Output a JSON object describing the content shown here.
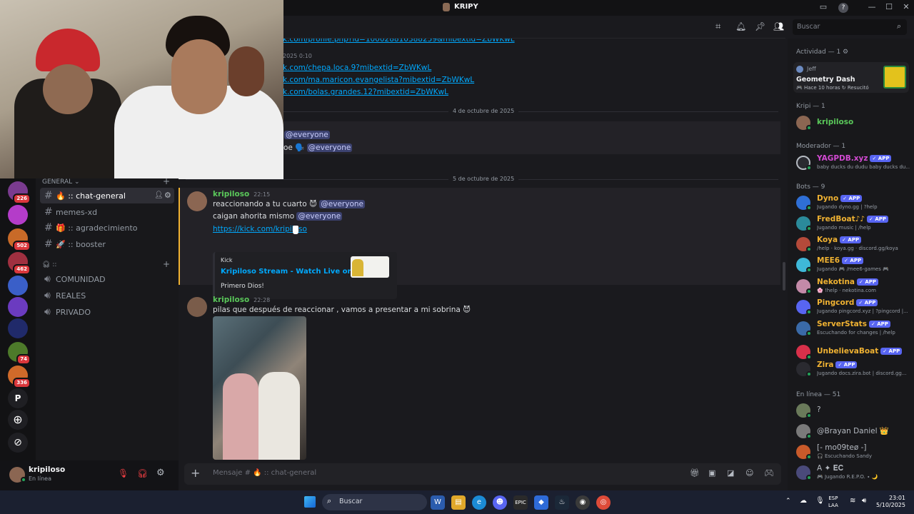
{
  "window": {
    "title": "KRIPY"
  },
  "header": {
    "search_placeholder": "Buscar"
  },
  "servers": {
    "badges": [
      "226",
      "502",
      "462",
      "74",
      "336"
    ],
    "letter": "P"
  },
  "channels": {
    "category_general": "GENERAL ⌄",
    "items": [
      {
        "label": "🔥 ꞉꞉ chat-general"
      },
      {
        "label": "memes-xd"
      },
      {
        "label": "🎁 ꞉꞉ agradecimiento"
      },
      {
        "label": "🚀 ꞉꞉ booster"
      }
    ],
    "voice_category": "꞉꞉",
    "voice": [
      "COMUNIDAD",
      "REALES",
      "PRIVADO"
    ]
  },
  "user": {
    "name": "kripiloso",
    "status": "En línea"
  },
  "chat": {
    "old_links": [
      "k.com/profile.php?id=100028810388259&mibextid=ZbWKwL",
      "2025 0:10",
      "k.com/chepa.loca.9?mibextid=ZbWKwL",
      "k.com/ma.maricon.evangelista?mibextid=ZbWKwL",
      "k.com/bolas.grandes.12?mibextid=ZbWKwL"
    ],
    "date1": "4 de octubre de 2025",
    "everyone1": "@everyone",
    "oe_prefix": "oe 🗣️",
    "everyone2": "@everyone",
    "date2": "5 de octubre de 2025",
    "msg1": {
      "author": "kripiloso",
      "time": "22:15",
      "line1": "reaccionando a tu cuarto 😈",
      "mention1": "@everyone",
      "line2": "caigan ahorita mismo",
      "mention2": "@everyone",
      "link": "https://kick.com/kripiloso",
      "embed": {
        "provider": "Kick",
        "title": "Kripiloso Stream - Watch Live on Kick",
        "desc": "Primero Dios!"
      }
    },
    "msg2": {
      "author": "kripiloso",
      "time": "22:28",
      "text": "pilas que después de reaccionar , vamos a presentar a mi sobrina 😈"
    },
    "input_placeholder": "Mensaje # 🔥 ꞉꞉ chat-general"
  },
  "members": {
    "activity_header": "Actividad — 1 ⚙",
    "activity": {
      "user": "Jeff",
      "game": "Geometry Dash",
      "sub": "🎮 Hace 10 horas  ↻ Resucitó"
    },
    "kripi_header": "Kripi — 1",
    "kripi": [
      {
        "name": "kripiloso",
        "color": "#5ac85a"
      }
    ],
    "mod_header": "Moderador — 1",
    "mods": [
      {
        "name": "YAGPDB.xyz",
        "tag": "✓ APP",
        "sub": "baby ducks du dudu baby ducks du...",
        "color": "#d24ad2"
      }
    ],
    "bots_header": "Bots — 9",
    "bots": [
      {
        "name": "Dyno",
        "sub": "Jugando dyno.gg | ?help",
        "color": "#f0b232"
      },
      {
        "name": "FredBoat♪♪",
        "sub": "Jugando music | /help",
        "color": "#f0b232"
      },
      {
        "name": "Koya",
        "sub": "/help · koya.gg · discord.gg/koya",
        "color": "#f0b232"
      },
      {
        "name": "MEE6",
        "sub": "Jugando 🎮 /mee6-games 🎮",
        "color": "#f0b232"
      },
      {
        "name": "Nekotina",
        "sub": "🌸 !help · nekotina.com",
        "color": "#f0b232"
      },
      {
        "name": "Pingcord",
        "sub": "Jugando pingcord.xyz | ?pingcord |...",
        "color": "#f0b232"
      },
      {
        "name": "ServerStats",
        "sub": "Escuchando for changes | /help",
        "color": "#f0b232"
      },
      {
        "name": "UnbelievaBoat",
        "sub": "",
        "color": "#f0b232"
      },
      {
        "name": "Zira",
        "sub": "Jugando docs.zira.bot | discord.gg...",
        "color": "#f0b232"
      }
    ],
    "app_tag": "✓ APP",
    "online_header": "En línea — 51",
    "online": [
      {
        "name": "?",
        "sub": ""
      },
      {
        "name": "@Brayan Daniel 👑",
        "sub": ""
      },
      {
        "name": "[- mo09teø -]",
        "sub": "🎧 Escuchando Sandy"
      },
      {
        "name": "A ✦ 𝐄𝐂",
        "sub": "🎮 Jugando R.E.P.O. ∙ 🌙"
      }
    ]
  },
  "taskbar": {
    "search": "Buscar",
    "lang1": "ESP",
    "lang2": "LAA",
    "time": "23:01",
    "date": "5/10/2025"
  }
}
